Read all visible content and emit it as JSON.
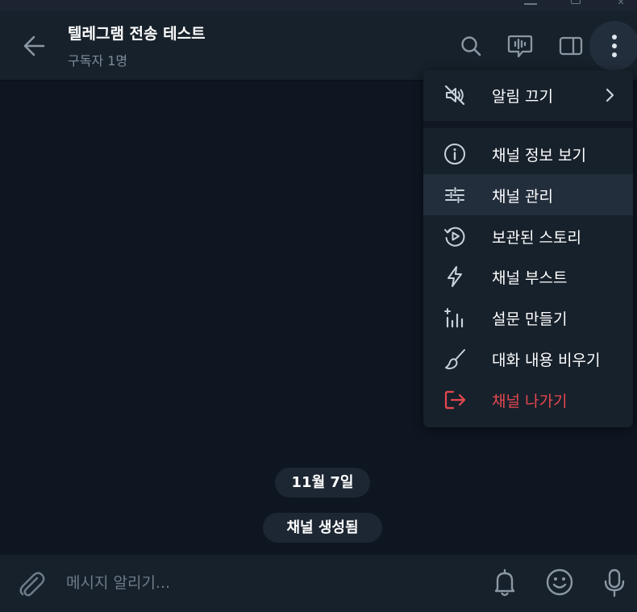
{
  "window": {
    "controls": [
      {
        "name": "minimize-icon"
      },
      {
        "name": "maximize-icon"
      },
      {
        "name": "close-icon",
        "glyph": "✕"
      }
    ]
  },
  "header": {
    "title": "텔레그램 전송 테스트",
    "subtitle": "구독자 1명",
    "icons": [
      "back-arrow-icon",
      "search-icon",
      "voice-chat-icon",
      "sidebar-toggle-icon",
      "more-vertical-icon"
    ]
  },
  "menu": {
    "mute": {
      "label": "알림 끄기",
      "icon": "mute-icon"
    },
    "items": [
      {
        "label": "채널 정보 보기",
        "icon": "info-icon"
      },
      {
        "label": "채널 관리",
        "icon": "sliders-icon"
      },
      {
        "label": "보관된 스토리",
        "icon": "story-archive-icon"
      },
      {
        "label": "채널 부스트",
        "icon": "lightning-icon"
      },
      {
        "label": "설문 만들기",
        "icon": "poll-icon"
      },
      {
        "label": "대화 내용 비우기",
        "icon": "broom-icon"
      },
      {
        "label": "채널 나가기",
        "icon": "leave-icon"
      }
    ]
  },
  "chat": {
    "date_label": "11월 7일",
    "service_message": "채널 생성됨"
  },
  "composer": {
    "placeholder": "메시지 알리기...",
    "icons": [
      "attach-icon",
      "bell-icon",
      "emoji-icon",
      "mic-icon"
    ]
  },
  "colors": {
    "background": "#0e1621",
    "panel": "#17212b",
    "hover": "#232e3c",
    "danger": "#e5474f",
    "muted_text": "#7d8b99"
  }
}
